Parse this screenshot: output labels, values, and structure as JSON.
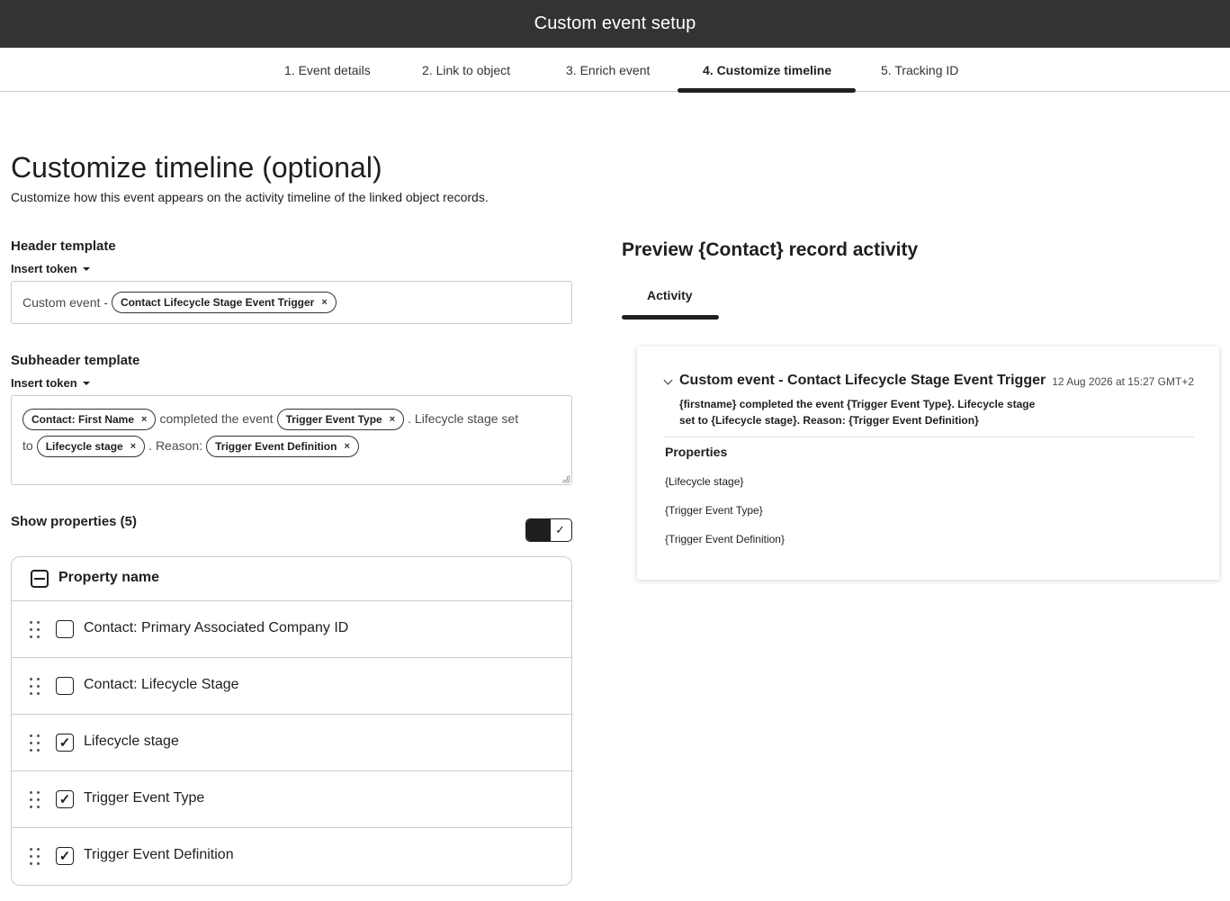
{
  "window": {
    "title": "Custom event setup"
  },
  "steps": [
    {
      "label": "1. Event details"
    },
    {
      "label": "2. Link to object"
    },
    {
      "label": "3. Enrich event"
    },
    {
      "label": "4. Customize timeline",
      "active": true
    },
    {
      "label": "5. Tracking ID"
    }
  ],
  "page": {
    "title": "Customize timeline (optional)",
    "subtitle": "Customize how this event appears on the activity timeline of the linked object records."
  },
  "header_template": {
    "label": "Header template",
    "insert_token": "Insert token",
    "prefix": "Custom event -",
    "token": "Contact Lifecycle Stage Event Trigger"
  },
  "subheader_template": {
    "label": "Subheader template",
    "insert_token": "Insert token",
    "token_first_name": "Contact: First Name",
    "text_completed": "completed the event",
    "token_trigger_type": "Trigger Event Type",
    "text_lifecycle": ". Lifecycle stage set",
    "text_to": "to",
    "token_lifecycle": "Lifecycle stage",
    "text_reason": ". Reason:",
    "token_definition": "Trigger Event Definition",
    "token_remove": "×"
  },
  "properties": {
    "label": "Show properties (5)",
    "toggle_on": true,
    "column_header": "Property name",
    "rows": [
      {
        "label": "Contact: Primary Associated Company ID",
        "checked": false
      },
      {
        "label": "Contact: Lifecycle Stage",
        "checked": false
      },
      {
        "label": "Lifecycle stage",
        "checked": true
      },
      {
        "label": "Trigger Event Type",
        "checked": true
      },
      {
        "label": "Trigger Event Definition",
        "checked": true
      }
    ]
  },
  "preview": {
    "title": "Preview {Contact} record activity",
    "tab": "Activity",
    "card": {
      "title": "Custom event - Contact Lifecycle Stage Event Trigger",
      "timestamp": "12 Aug 2026 at 15:27 GMT+2",
      "body": "{firstname} completed the event {Trigger Event Type}. Lifecycle stage set to {Lifecycle stage}. Reason: {Trigger Event Definition}",
      "properties_label": "Properties",
      "properties": [
        "{Lifecycle stage}",
        "{Trigger Event Type}",
        "{Trigger Event Definition}"
      ]
    }
  },
  "icons": {
    "check": "✓",
    "token_remove": "×",
    "caret": "caret-down-icon",
    "drag": "drag-handle-icon",
    "chevron": "chevron-down-icon"
  },
  "colors": {
    "topbar": "#333333",
    "text": "#1f1f1f",
    "border": "#cbcbcb"
  }
}
